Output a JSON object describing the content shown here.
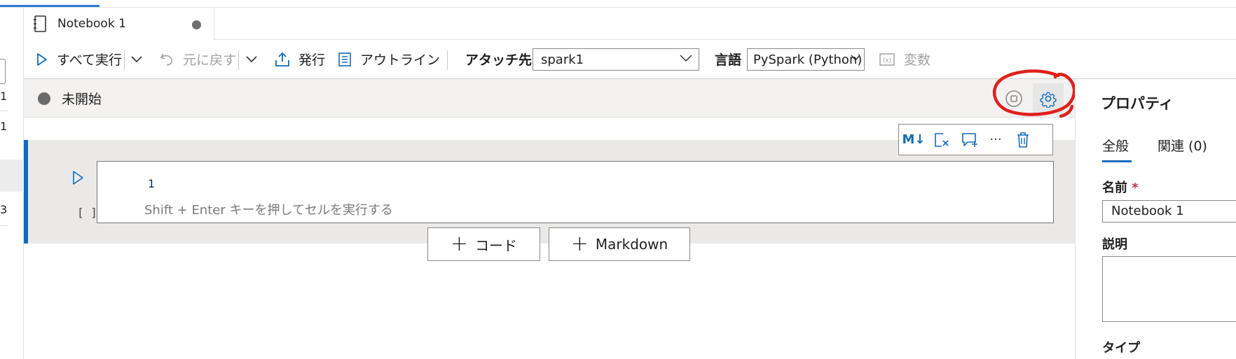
{
  "tab": {
    "title": "Notebook 1"
  },
  "toolbar": {
    "run_all": "すべて実行",
    "undo": "元に戻す",
    "publish": "発行",
    "outline": "アウトライン",
    "attach_label": "アタッチ先",
    "attach_value": "spark1",
    "language_label": "言語",
    "language_value": "PySpark (Python)",
    "variables": "変数"
  },
  "status": {
    "text": "未開始"
  },
  "cell": {
    "line_number": "1",
    "hint": "Shift + Enter キーを押してセルを実行する",
    "exec_count": "[ ]",
    "toolbar": {
      "markdown_label": "M↓",
      "more_label": "···"
    }
  },
  "add": {
    "code": "コード",
    "markdown": "Markdown"
  },
  "properties": {
    "title": "プロパティ",
    "tab_general": "全般",
    "tab_related": "関連 (0)",
    "name_label": "名前",
    "required_mark": "*",
    "name_value": "Notebook 1",
    "description_label": "説明",
    "type_label": "タイプ"
  },
  "left_rail": {
    "numbers": [
      "1",
      "1",
      "3"
    ]
  },
  "colors": {
    "accent": "#0f6cbd",
    "annotation": "#e0201b"
  }
}
